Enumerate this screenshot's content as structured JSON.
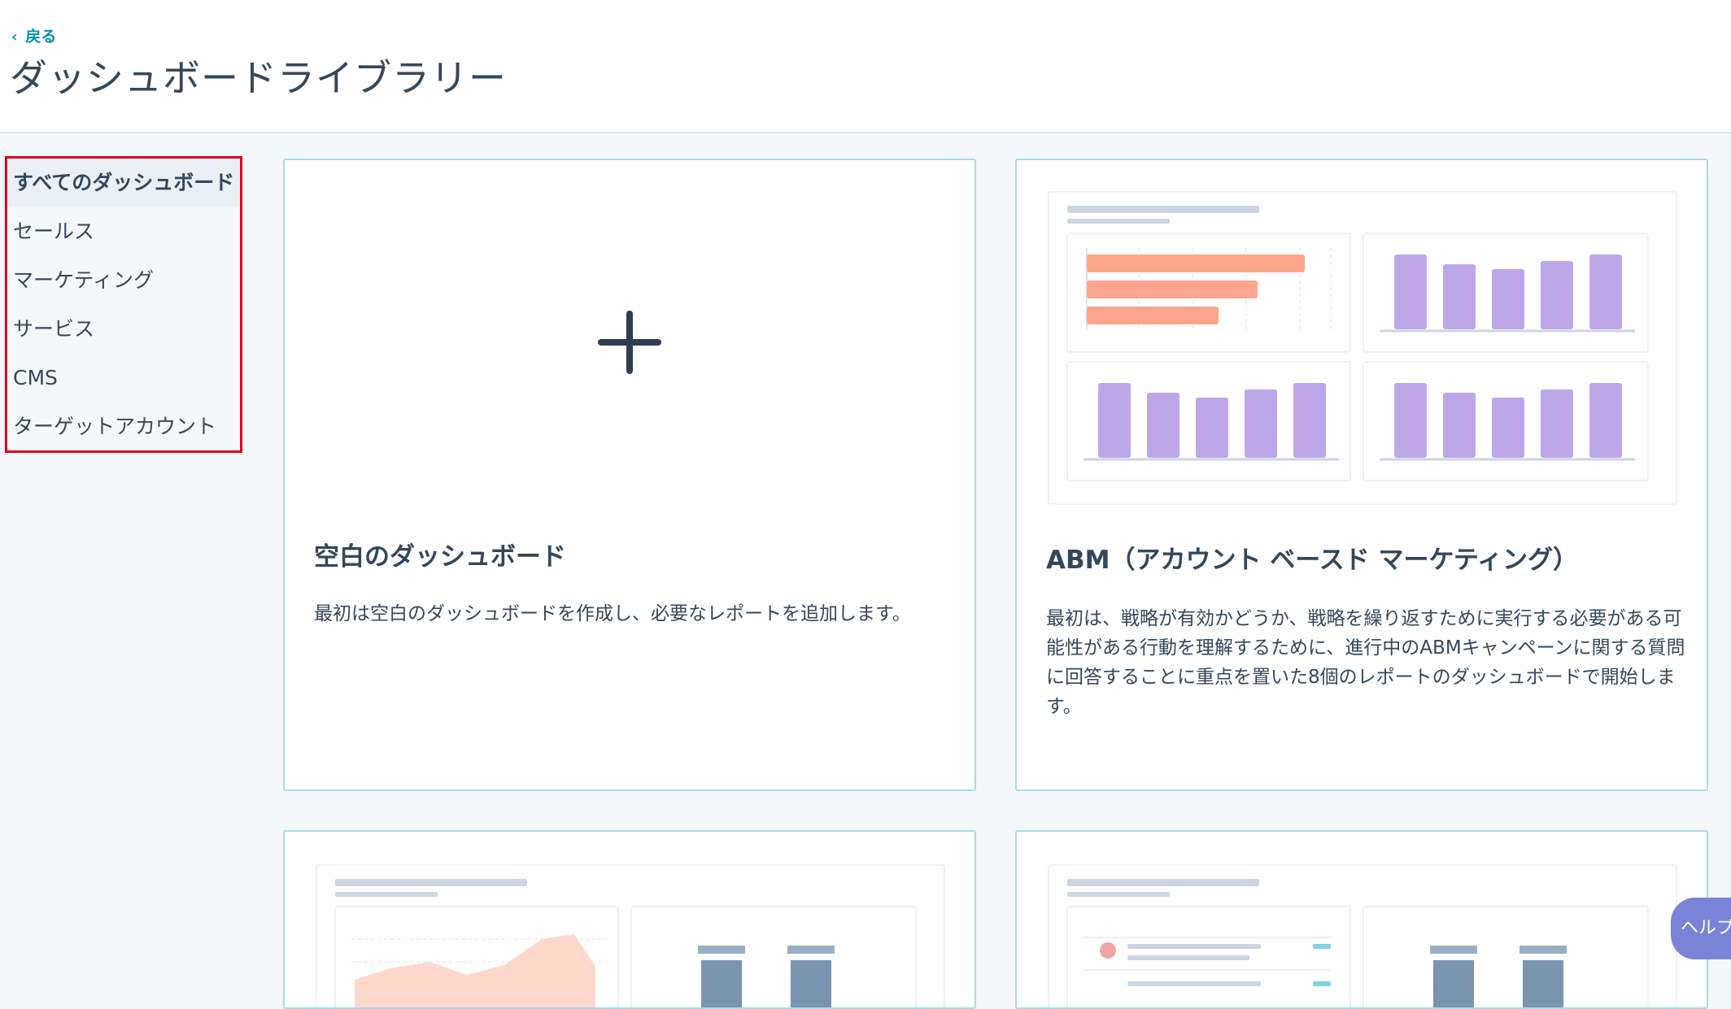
{
  "header": {
    "back_label": "戻る",
    "title": "ダッシュボードライブラリー"
  },
  "sidebar": {
    "items": [
      {
        "label": "すべてのダッシュボード",
        "active": true
      },
      {
        "label": "セールス"
      },
      {
        "label": "マーケティング"
      },
      {
        "label": "サービス"
      },
      {
        "label": "CMS"
      },
      {
        "label": "ターゲットアカウント"
      }
    ]
  },
  "cards": [
    {
      "title": "空白のダッシュボード",
      "description": "最初は空白のダッシュボードを作成し、必要なレポートを追加します。",
      "preview_icon": "plus-icon"
    },
    {
      "title": "ABM（アカウント ベースド マーケティング）",
      "description": "最初は、戦略が有効かどうか、戦略を繰り返すために実行する必要がある可能性がある行動を理解するために、進行中のABMキャンペーンに関する質問に回答することに重点を置いた8個のレポートのダッシュボードで開始します。",
      "preview_icon": "dashboard-preview-bar-charts"
    },
    {
      "preview_icon": "dashboard-preview-area-chart"
    },
    {
      "preview_icon": "dashboard-preview-list"
    }
  ],
  "help": {
    "label": "ヘルプ"
  },
  "colors": {
    "accent": "#0091ae",
    "bar_purple": "#bea7e9",
    "bar_salmon": "#fea58e",
    "highlight_border": "#e0001b",
    "card_border": "#a9d9e6"
  }
}
